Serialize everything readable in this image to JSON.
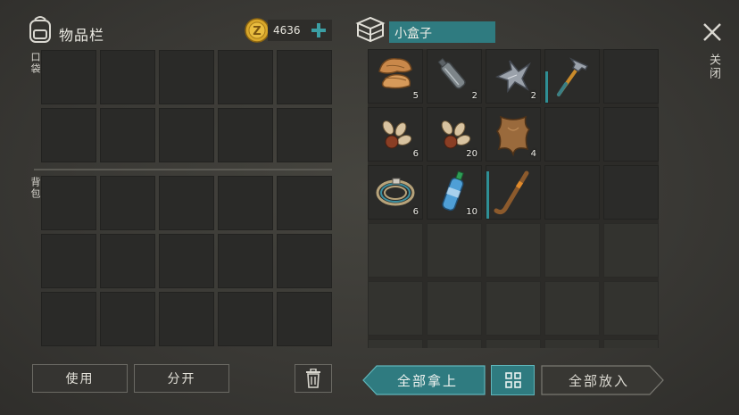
{
  "inventory": {
    "title": "物品栏",
    "coins": "4636",
    "pocket_label": "口袋",
    "backpack_label": "背包"
  },
  "container": {
    "title": "小盒子",
    "close_label": "关闭",
    "items": [
      {
        "icon": "mushroom-icon",
        "count": "5"
      },
      {
        "icon": "empty-bottle-icon",
        "count": "2"
      },
      {
        "icon": "scrap-metal-icon",
        "count": "2"
      },
      {
        "icon": "hammer-icon",
        "count": ""
      },
      {
        "icon": "seeds-icon",
        "count": "6"
      },
      {
        "icon": "seeds-icon",
        "count": "20"
      },
      {
        "icon": "animal-hide-icon",
        "count": "4"
      },
      {
        "icon": "rope-icon",
        "count": "6"
      },
      {
        "icon": "water-bottle-icon",
        "count": "10"
      },
      {
        "icon": "hockey-stick-icon",
        "count": ""
      }
    ]
  },
  "buttons": {
    "use": "使用",
    "split": "分开",
    "take_all": "全部拿上",
    "put_all": "全部放入"
  },
  "colors": {
    "accent_teal": "#2f7b80",
    "coin_gold": "#d8a72a"
  }
}
